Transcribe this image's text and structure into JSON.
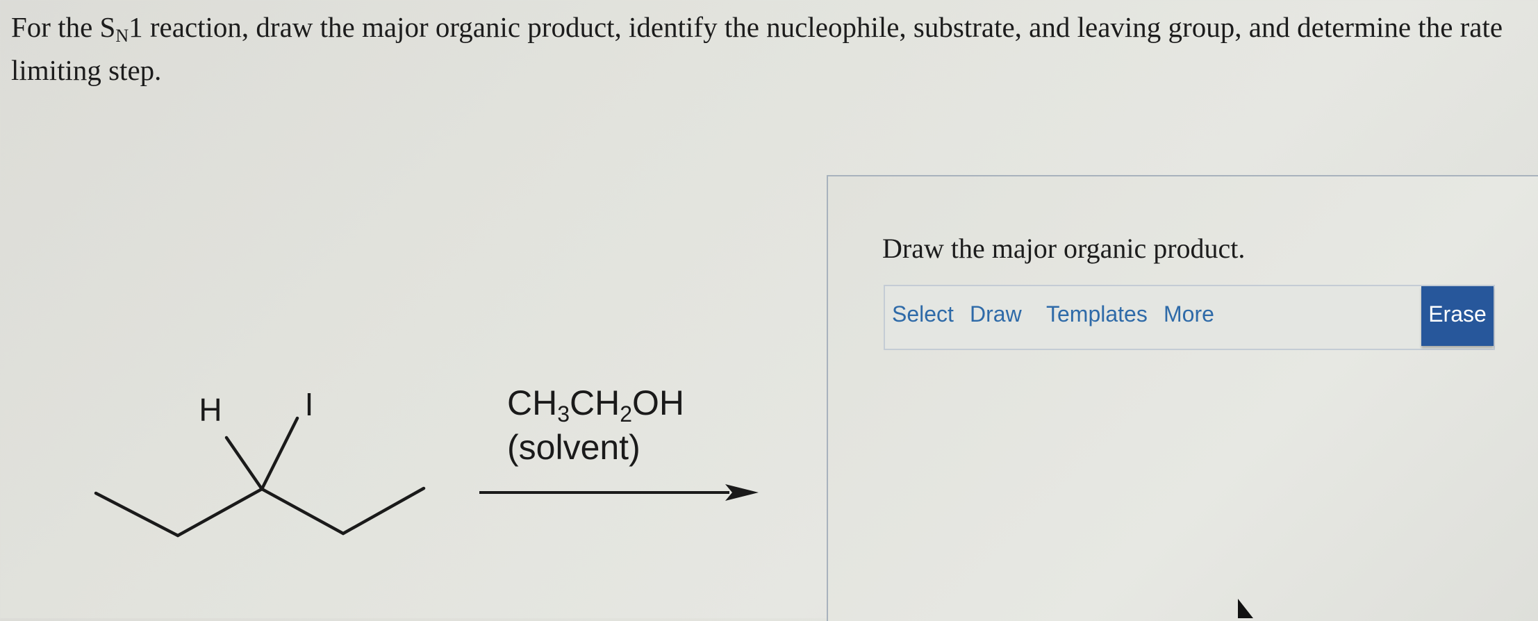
{
  "question": {
    "text_before": "For the S",
    "subscript": "N",
    "text_after": "1 reaction, draw the major organic product, identify the nucleophile, substrate, and leaving group, and determine the rate limiting step."
  },
  "reaction": {
    "substrate_labels": {
      "h": "H",
      "i": "I"
    },
    "reagent": {
      "ch3": "CH",
      "ch3_sub": "3",
      "ch2": "CH",
      "ch2_sub": "2",
      "oh": "OH",
      "solvent_label": "(solvent)"
    }
  },
  "panel": {
    "title": "Draw the major organic product.",
    "toolbar": {
      "select": "Select",
      "draw": "Draw",
      "templates": "Templates",
      "more": "More",
      "erase": "Erase"
    }
  },
  "colors": {
    "accent": "#27579b",
    "link": "#2e6aa8",
    "border": "#a8b2bd"
  },
  "icons": {
    "cursor": "pointer-cursor-icon"
  }
}
